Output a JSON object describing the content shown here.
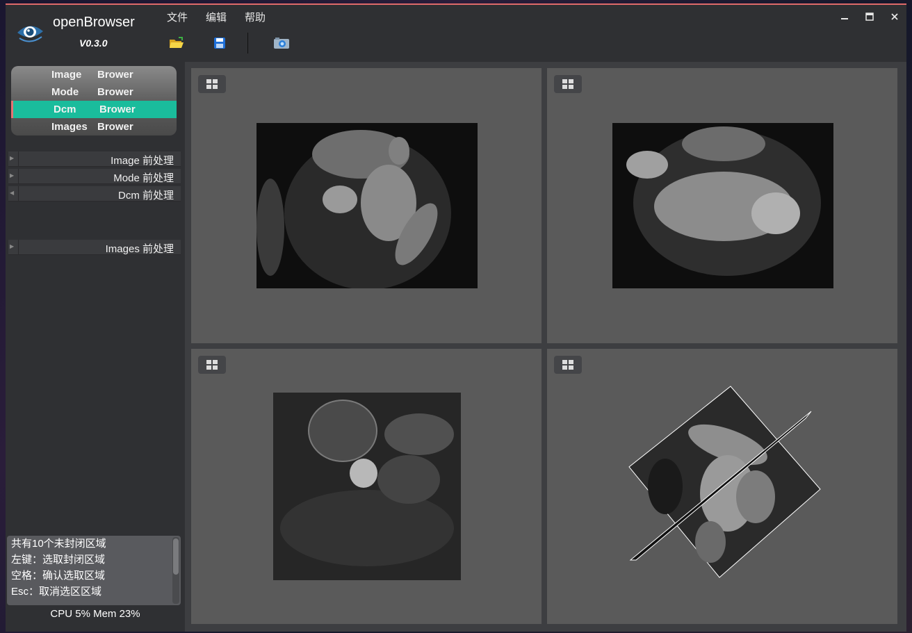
{
  "app": {
    "title": "openBrowser",
    "version": "V0.3.0"
  },
  "menu": {
    "items": [
      "文件",
      "编辑",
      "帮助"
    ]
  },
  "toolbar": {
    "open_icon": "folder-open-icon",
    "save_icon": "save-disk-icon",
    "screenshot_icon": "camera-icon"
  },
  "window_controls": {
    "minimize": "▬",
    "maximize": "▣",
    "close": "✕"
  },
  "browse_panel": {
    "rows": [
      {
        "word1": "Image",
        "word2": "Brower",
        "active": false
      },
      {
        "word1": "Mode",
        "word2": "Brower",
        "active": false
      },
      {
        "word1": "Dcm",
        "word2": "Brower",
        "active": true
      },
      {
        "word1": "Images",
        "word2": "Brower",
        "active": false
      }
    ]
  },
  "preprocess": {
    "items": [
      {
        "label": "Image  前处理"
      },
      {
        "label": "Mode  前处理"
      },
      {
        "label": "Dcm  前处理"
      },
      {
        "label": "Images  前处理"
      }
    ]
  },
  "info": {
    "lines": [
      "共有10个未封闭区域",
      "左键：选取封闭区域",
      "空格：确认选取区域",
      "Esc：取消选区区域"
    ]
  },
  "status": {
    "text": "CPU 5%  Mem 23%"
  },
  "colors": {
    "accent": "#1abc9c",
    "active_marker": "#e57373",
    "top_border": "#e06a6a"
  },
  "viewports": [
    {
      "name": "axial-view",
      "layout_icon": "grid-layout-icon"
    },
    {
      "name": "coronal-view",
      "layout_icon": "grid-layout-icon"
    },
    {
      "name": "sagittal-view",
      "layout_icon": "grid-layout-icon"
    },
    {
      "name": "3d-view",
      "layout_icon": "grid-layout-icon"
    }
  ]
}
